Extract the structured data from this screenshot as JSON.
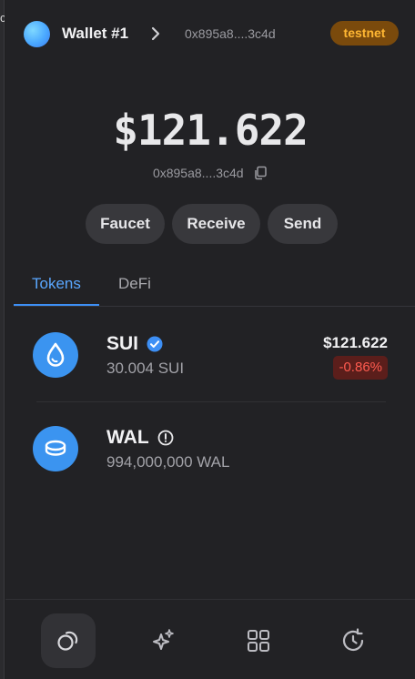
{
  "edge": {
    "glyph": "c"
  },
  "header": {
    "wallet_name": "Wallet #1",
    "address": "0x895a8....3c4d",
    "network_badge": "testnet"
  },
  "balance": {
    "amount": "$121.622",
    "address": "0x895a8....3c4d"
  },
  "actions": {
    "faucet": "Faucet",
    "receive": "Receive",
    "send": "Send"
  },
  "tabs": [
    {
      "label": "Tokens",
      "active": true
    },
    {
      "label": "DeFi",
      "active": false
    }
  ],
  "tokens": [
    {
      "symbol": "SUI",
      "amount": "30.004 SUI",
      "value": "$121.622",
      "change": "-0.86%",
      "verified": true,
      "icon": "sui-drop-icon"
    },
    {
      "symbol": "WAL",
      "amount": "994,000,000 WAL",
      "value": "",
      "change": "",
      "verified": false,
      "icon": "walrus-coin-icon"
    }
  ],
  "nav": [
    {
      "name": "home",
      "icon": "coins-icon",
      "active": true
    },
    {
      "name": "discover",
      "icon": "sparkles-icon",
      "active": false
    },
    {
      "name": "apps",
      "icon": "grid-icon",
      "active": false
    },
    {
      "name": "history",
      "icon": "clock-history-icon",
      "active": false
    }
  ],
  "colors": {
    "accent": "#3d8ff5",
    "badge_bg": "#7a4a0c",
    "badge_text": "#ffb733",
    "negative": "#ff5b4f",
    "token_icon": "#3b94f0"
  }
}
